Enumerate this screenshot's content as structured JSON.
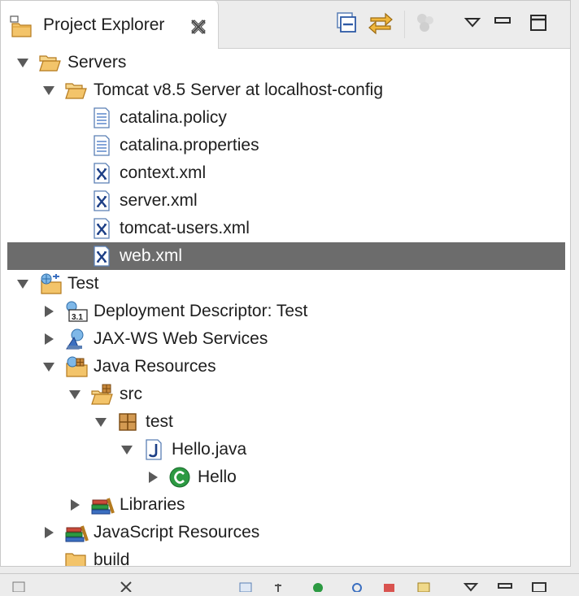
{
  "view": {
    "title": "Project Explorer",
    "icons": {
      "tab": "project-explorer-icon",
      "close": "close-icon",
      "collapse_all": "collapse-all-icon",
      "link_with_editor": "link-with-editor-icon",
      "filters": "filters-icon",
      "view_menu": "view-menu-icon",
      "minimize": "minimize-icon",
      "maximize": "maximize-icon"
    }
  },
  "tree": {
    "rows": [
      {
        "label": "Servers",
        "depth": 0,
        "expander": "expanded",
        "icon": "folder-open-icon"
      },
      {
        "label": "Tomcat v8.5 Server at localhost-config",
        "depth": 1,
        "expander": "expanded",
        "icon": "folder-open-icon"
      },
      {
        "label": "catalina.policy",
        "depth": 2,
        "expander": "none",
        "icon": "text-file-icon"
      },
      {
        "label": "catalina.properties",
        "depth": 2,
        "expander": "none",
        "icon": "text-file-icon"
      },
      {
        "label": "context.xml",
        "depth": 2,
        "expander": "none",
        "icon": "xml-file-icon"
      },
      {
        "label": "server.xml",
        "depth": 2,
        "expander": "none",
        "icon": "xml-file-icon"
      },
      {
        "label": "tomcat-users.xml",
        "depth": 2,
        "expander": "none",
        "icon": "xml-file-icon"
      },
      {
        "label": "web.xml",
        "depth": 2,
        "expander": "none",
        "icon": "xml-file-icon",
        "selected": true
      },
      {
        "label": "Test",
        "depth": 0,
        "expander": "expanded",
        "icon": "web-project-icon"
      },
      {
        "label": "Deployment Descriptor: Test",
        "depth": 1,
        "expander": "collapsed",
        "icon": "deployment-descriptor-icon"
      },
      {
        "label": "JAX-WS Web Services",
        "depth": 1,
        "expander": "collapsed",
        "icon": "web-services-icon"
      },
      {
        "label": "Java Resources",
        "depth": 1,
        "expander": "expanded",
        "icon": "java-resources-icon"
      },
      {
        "label": "src",
        "depth": 2,
        "expander": "expanded",
        "icon": "source-folder-icon"
      },
      {
        "label": "test",
        "depth": 3,
        "expander": "expanded",
        "icon": "package-icon"
      },
      {
        "label": "Hello.java",
        "depth": 4,
        "expander": "expanded",
        "icon": "java-file-icon"
      },
      {
        "label": "Hello",
        "depth": 5,
        "expander": "collapsed",
        "icon": "class-icon"
      },
      {
        "label": "Libraries",
        "depth": 2,
        "expander": "collapsed",
        "icon": "libraries-icon"
      },
      {
        "label": "JavaScript Resources",
        "depth": 1,
        "expander": "collapsed",
        "icon": "libraries-icon"
      },
      {
        "label": "build",
        "depth": 1,
        "expander": "none",
        "icon": "folder-icon"
      }
    ]
  },
  "colors": {
    "selection": "#6c6c6c",
    "folder": "#e8a33d",
    "accent_blue": "#3b6fc0",
    "class_green": "#2c9a42"
  }
}
